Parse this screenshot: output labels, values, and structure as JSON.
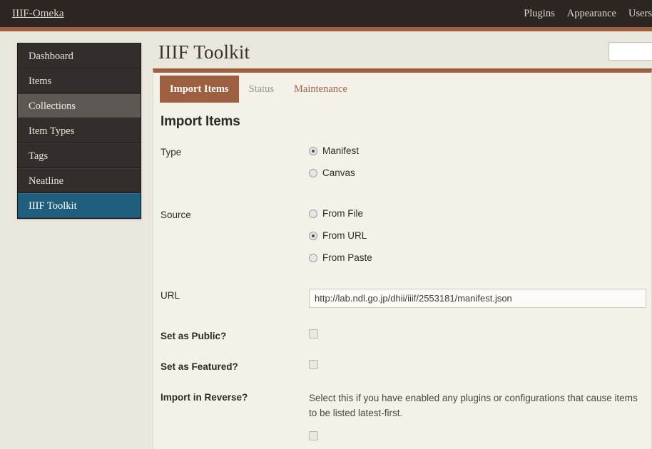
{
  "topbar": {
    "brand": "IIIF-Omeka",
    "nav": [
      {
        "label": "Plugins"
      },
      {
        "label": "Appearance"
      },
      {
        "label": "Users"
      }
    ]
  },
  "search": {
    "value": "",
    "placeholder": ""
  },
  "sidebar": {
    "items": [
      {
        "label": "Dashboard",
        "state": "normal"
      },
      {
        "label": "Items",
        "state": "normal"
      },
      {
        "label": "Collections",
        "state": "hovered"
      },
      {
        "label": "Item Types",
        "state": "normal"
      },
      {
        "label": "Tags",
        "state": "normal"
      },
      {
        "label": "Neatline",
        "state": "normal"
      },
      {
        "label": "IIIF Toolkit",
        "state": "active"
      }
    ]
  },
  "main": {
    "page_title": "IIIF Toolkit",
    "tabs": [
      {
        "label": "Import Items",
        "state": "active"
      },
      {
        "label": "Status",
        "state": "muted"
      },
      {
        "label": "Maintenance",
        "state": "link"
      }
    ],
    "section_title": "Import Items",
    "fields": {
      "type": {
        "label": "Type",
        "options": [
          {
            "label": "Manifest",
            "checked": true
          },
          {
            "label": "Canvas",
            "checked": false
          }
        ]
      },
      "source": {
        "label": "Source",
        "options": [
          {
            "label": "From File",
            "checked": false
          },
          {
            "label": "From URL",
            "checked": true
          },
          {
            "label": "From Paste",
            "checked": false
          }
        ]
      },
      "url": {
        "label": "URL",
        "value": "http://lab.ndl.go.jp/dhii/iiif/2553181/manifest.json",
        "placeholder": ""
      },
      "set_public": {
        "label": "Set as Public?",
        "checked": false
      },
      "set_featured": {
        "label": "Set as Featured?",
        "checked": false
      },
      "import_reverse": {
        "label": "Import in Reverse?",
        "help": "Select this if you have enabled any plugins or configurations that cause items to be listed latest-first.",
        "checked": false
      }
    }
  },
  "colors": {
    "topbar_bg": "#2c2521",
    "accent_brown": "#9c5f3f",
    "sidebar_active": "#1f5e7d",
    "page_bg": "#e9e7db",
    "panel_bg": "#f3f1e8"
  }
}
